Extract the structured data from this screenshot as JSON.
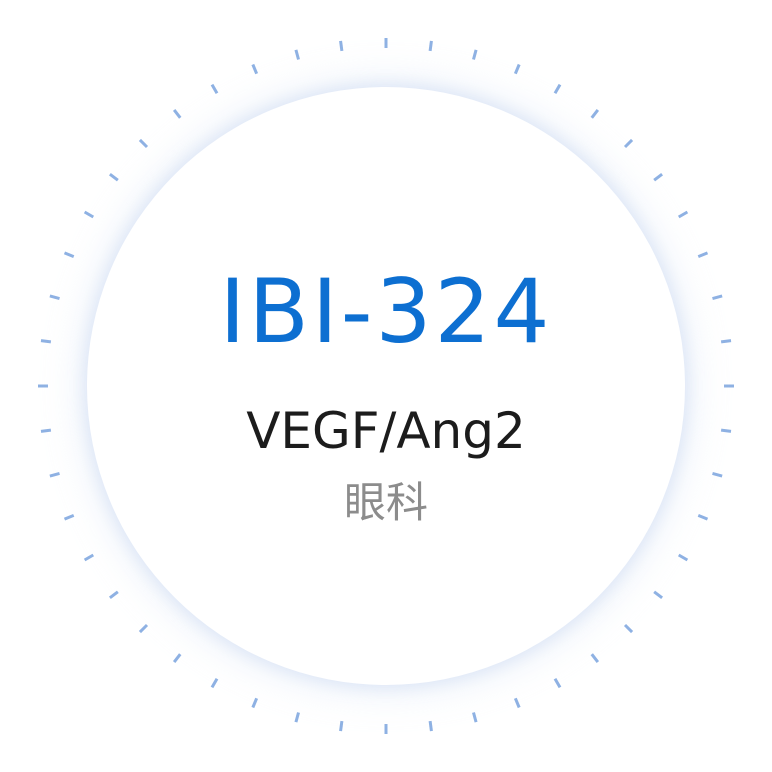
{
  "product": {
    "code": "IBI-324",
    "target": "VEGF/Ang2",
    "therapeutic_area": "眼科"
  },
  "colors": {
    "code": "#0d6fd1",
    "target": "#1c1c1c",
    "therapeutic_area": "#8c8c8c",
    "tick": "#8eb1e3"
  }
}
